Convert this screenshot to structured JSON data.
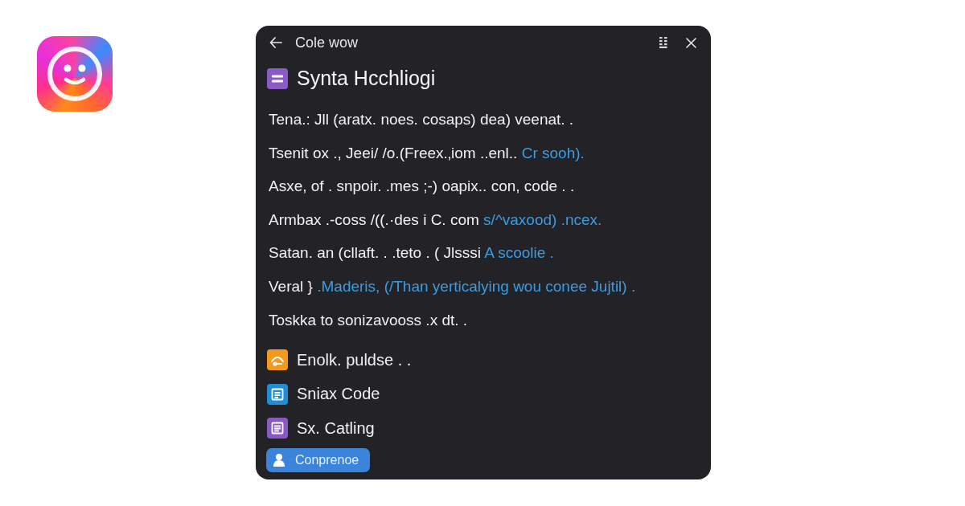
{
  "window": {
    "title": "Cole wow"
  },
  "heading": {
    "text": "Synta Hcchliogi"
  },
  "lines": [
    {
      "segments": [
        {
          "text": "Tena.: Jll (aratx. noes. cosaps) dea) veenat. .",
          "kind": "plain"
        }
      ]
    },
    {
      "segments": [
        {
          "text": "Tsenit ox ., Jeei/ /o.(Freex.‚iom ..enl..",
          "kind": "plain"
        },
        {
          "text": " Cr sooh).",
          "kind": "highlight"
        }
      ]
    },
    {
      "segments": [
        {
          "text": "Asxe, of . snpoir. .mes ;-) oapix.. con, code . .",
          "kind": "plain"
        }
      ]
    },
    {
      "segments": [
        {
          "text": "Armbax .-coss /((.·des i C. com",
          "kind": "plain"
        },
        {
          "text": " s/^vaxood) .ncex.",
          "kind": "highlight"
        }
      ]
    },
    {
      "segments": [
        {
          "text": "Satan. an (cllaft. . .teto . ( Jlsssi",
          "kind": "plain"
        },
        {
          "text": " A scoolie .",
          "kind": "highlight"
        }
      ]
    },
    {
      "segments": [
        {
          "text": "Veral } ",
          "kind": "plain"
        },
        {
          "text": ".Maderis, (/Than yerticalying wou conee Jujtil) .",
          "kind": "highlight"
        }
      ]
    },
    {
      "segments": [
        {
          "text": "Toskka to sonizavooss .x dt. .",
          "kind": "plain"
        }
      ]
    }
  ],
  "items": [
    {
      "label": "Enolk. puldse . .",
      "color": "#f39a1e"
    },
    {
      "label": "Sniax Code",
      "color": "#1f8fd4"
    },
    {
      "label": "Sx. Catling",
      "color": "#8a5ac4"
    }
  ],
  "button": {
    "label": "Conprenoe"
  }
}
